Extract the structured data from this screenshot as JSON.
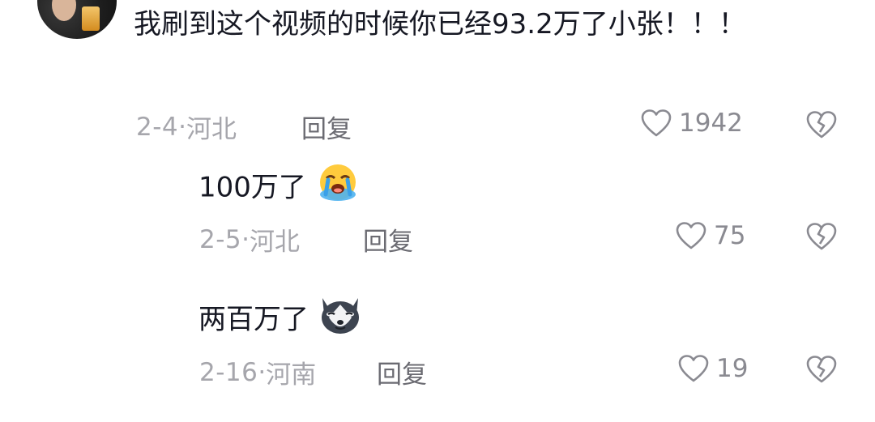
{
  "comments": [
    {
      "text": "我刷到这个视频的时候你已经93.2万了小张！！！",
      "date": "2-4",
      "location": "河北",
      "reply_label": "回复",
      "likes": "1942"
    },
    {
      "text": "100万了",
      "emoji": "loudly-crying-face",
      "date": "2-5",
      "location": "河北",
      "reply_label": "回复",
      "likes": "75"
    },
    {
      "text": "两百万了",
      "emoji": "husky-dog-face",
      "date": "2-16",
      "location": "河南",
      "reply_label": "回复",
      "likes": "19"
    }
  ],
  "colors": {
    "text": "#161823",
    "meta": "#a6a6ac",
    "icon": "#8a8a91"
  }
}
